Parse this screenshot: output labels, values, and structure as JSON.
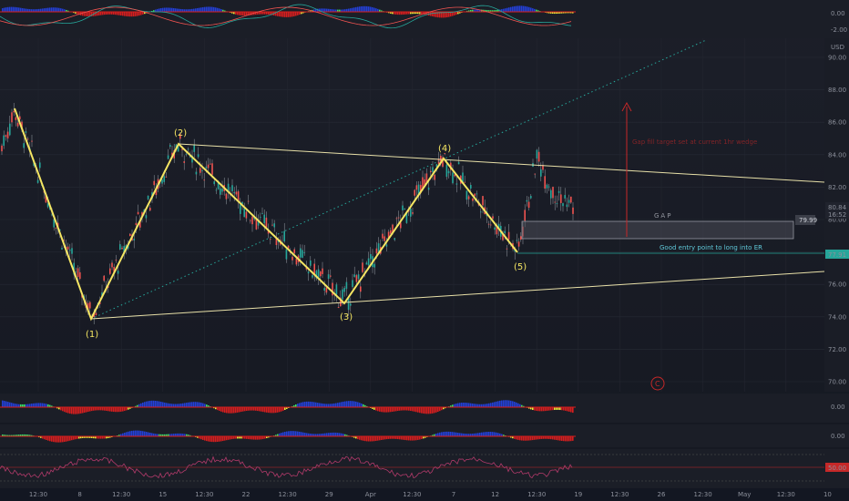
{
  "currency": "USD",
  "price_axis": {
    "ticks": [
      "90.00",
      "88.00",
      "86.00",
      "84.00",
      "82.00",
      "80.00",
      "78.00",
      "76.00",
      "74.00",
      "72.00",
      "70.00"
    ],
    "last_price": "80.84",
    "countdown": "16:52"
  },
  "time_axis": [
    "12:30",
    "8",
    "12:30",
    "15",
    "12:30",
    "22",
    "12:30",
    "29",
    "Apr",
    "12:30",
    "7",
    "12",
    "12:30",
    "19",
    "12:30",
    "26",
    "12:30",
    "May",
    "12:30",
    "10"
  ],
  "waves": [
    "(1)",
    "(2)",
    "(3)",
    "(4)",
    "(5)"
  ],
  "annotations": {
    "gap_label": "GAP",
    "gap_price": "79.99",
    "entry_text": "Good entry point to long into ER",
    "entry_price": "77.91",
    "target_text": "Gap fill target set at current 1hr wedge"
  },
  "indicator_panes": {
    "top_ticks": [
      "0.00",
      "-2.00"
    ],
    "macd1_ticks": [
      "0.00"
    ],
    "macd2_ticks": [
      "0.00"
    ],
    "rsi_ticks": [
      "50.00"
    ],
    "rsi_value": "50.00"
  },
  "colors": {
    "background": "#1a1d26",
    "wave": "#f5e663",
    "wedge": "#e8e0a8",
    "channel": "#26a69a",
    "target": "#c62828",
    "candle_up": "#26a69a",
    "candle_down": "#ef5350",
    "hist_green": "#38e26c",
    "hist_blue": "#2440d8",
    "hist_red": "#d81e1e",
    "hist_yellow": "#f4ea38"
  },
  "logo_icon": "tradingview-c-icon"
}
